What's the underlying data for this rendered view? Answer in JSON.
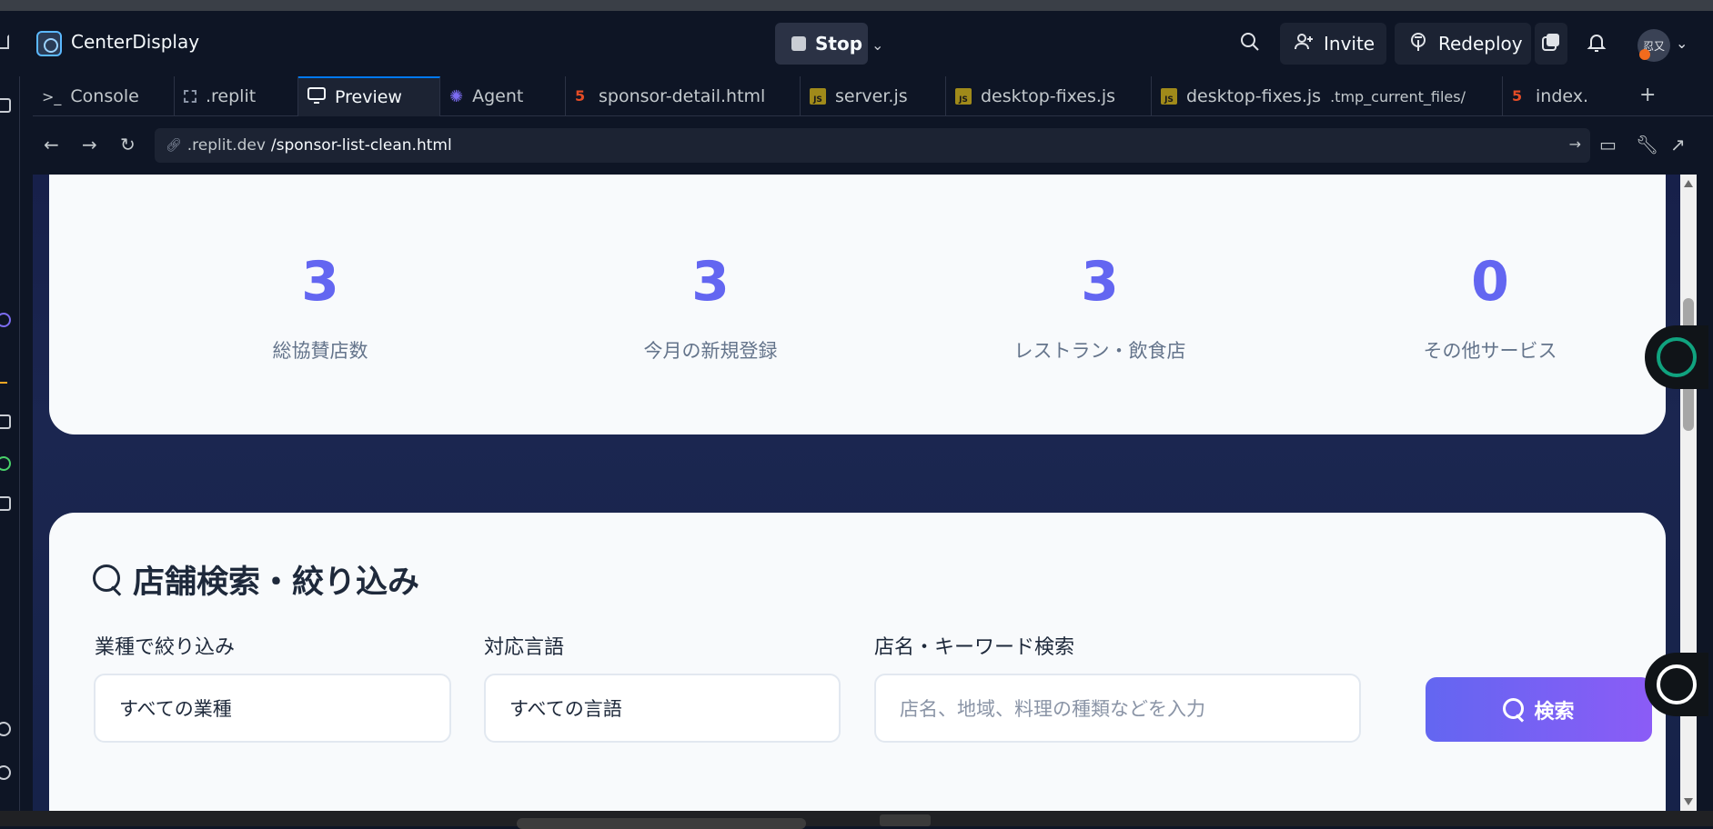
{
  "window": {
    "title": "CenterDisplay"
  },
  "header": {
    "stop_label": "Stop",
    "invite_label": "Invite",
    "redeploy_label": "Redeploy",
    "avatar_text": "忍又"
  },
  "tabs": [
    {
      "label": "Console",
      "icon": "console-icon"
    },
    {
      "label": ".replit",
      "icon": "replit-config-icon"
    },
    {
      "label": "Preview",
      "icon": "monitor-icon",
      "active": true
    },
    {
      "label": "Agent",
      "icon": "agent-icon"
    },
    {
      "label": "sponsor-detail.html",
      "icon": "html-icon"
    },
    {
      "label": "server.js",
      "icon": "js-icon"
    },
    {
      "label": "desktop-fixes.js",
      "icon": "js-icon"
    },
    {
      "label": "desktop-fixes.js",
      "sublabel": ".tmp_current_files/",
      "icon": "js-icon"
    },
    {
      "label": "index.",
      "icon": "html-icon"
    }
  ],
  "urlbar": {
    "domain": ".replit.dev",
    "path": "/sponsor-list-clean.html"
  },
  "stats": [
    {
      "value": "3",
      "label": "総協賛店数"
    },
    {
      "value": "3",
      "label": "今月の新規登録"
    },
    {
      "value": "3",
      "label": "レストラン・飲食店"
    },
    {
      "value": "0",
      "label": "その他サービス"
    }
  ],
  "search": {
    "title": "店舗検索・絞り込み",
    "category_label": "業種で絞り込み",
    "category_value": "すべての業種",
    "language_label": "対応言語",
    "language_value": "すべての言語",
    "keyword_label": "店名・キーワード検索",
    "keyword_placeholder": "店名、地域、料理の種類などを入力",
    "button_label": "検索"
  },
  "colors": {
    "accent": "#6366f1",
    "accent2": "#8b5cf6",
    "ide_bg": "#0e1525"
  }
}
